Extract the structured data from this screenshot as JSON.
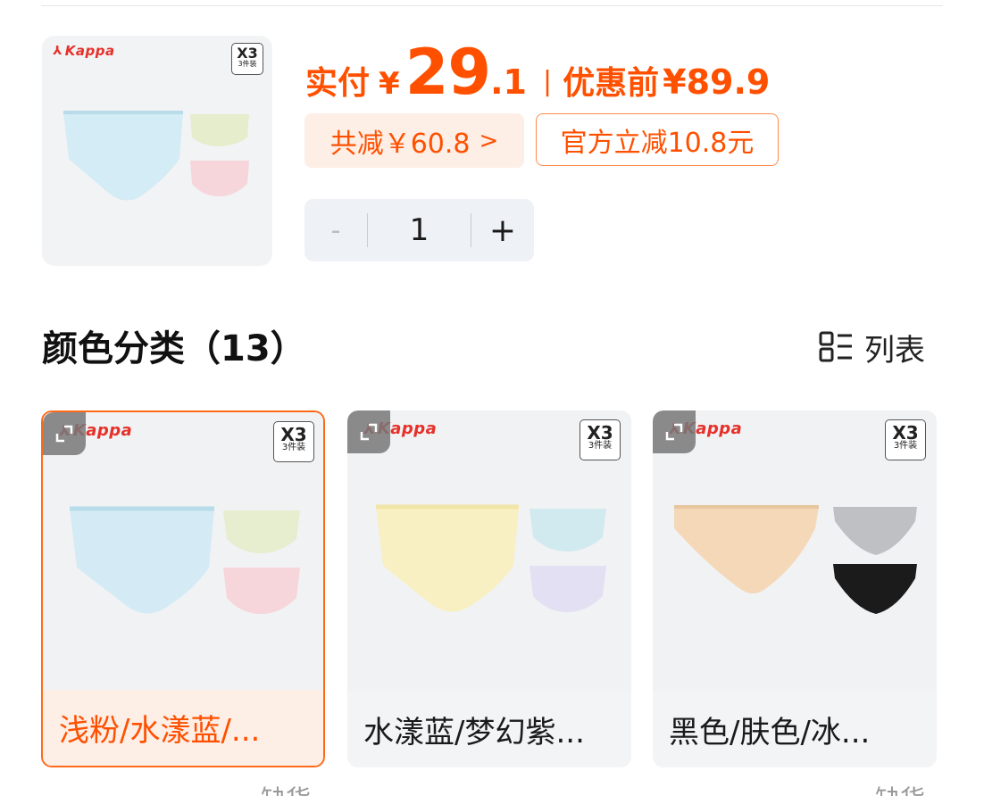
{
  "product": {
    "brand": "Kappa",
    "pack_top": "X3",
    "pack_bottom": "3件装"
  },
  "price": {
    "label": "实付",
    "currency": "¥",
    "integer": "29",
    "decimal": ".1",
    "separator": "|",
    "before_label": "优惠前",
    "before_value": "¥89.9"
  },
  "discount": {
    "total_label": "共减￥60.8",
    "chevron": ">",
    "official": "官方立减10.8元"
  },
  "stepper": {
    "minus": "-",
    "quantity": "1",
    "plus": "+"
  },
  "section": {
    "title": "颜色分类（13）",
    "view_toggle_label": "列表"
  },
  "variants": [
    {
      "label": "浅粉/水漾蓝/...",
      "selected": true
    },
    {
      "label": "水漾蓝/梦幻紫...",
      "selected": false
    },
    {
      "label": "黑色/肤色/冰...",
      "selected": false
    }
  ],
  "cut_off": [
    "缺货",
    "缺货"
  ],
  "colors": {
    "accent": "#ff5000",
    "chip_bg": "#fdeee6",
    "card_bg": "#f3f4f6",
    "brand_red": "#e5312a"
  }
}
